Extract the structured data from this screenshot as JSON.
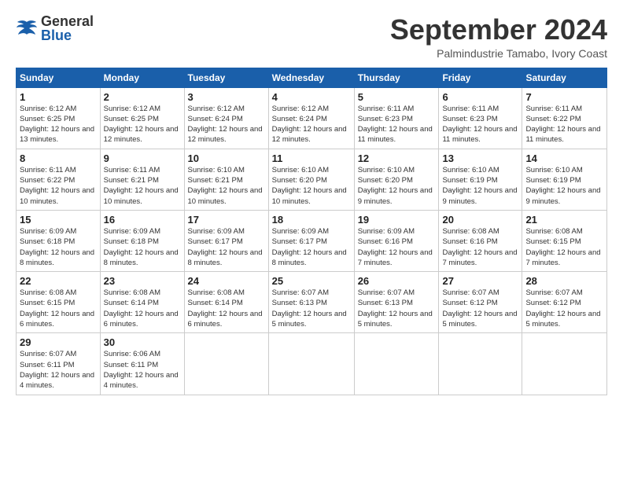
{
  "header": {
    "logo_general": "General",
    "logo_blue": "Blue",
    "month_title": "September 2024",
    "location": "Palmindustrie Tamabo, Ivory Coast"
  },
  "days_of_week": [
    "Sunday",
    "Monday",
    "Tuesday",
    "Wednesday",
    "Thursday",
    "Friday",
    "Saturday"
  ],
  "weeks": [
    [
      {
        "day": "1",
        "sunrise": "Sunrise: 6:12 AM",
        "sunset": "Sunset: 6:25 PM",
        "daylight": "Daylight: 12 hours and 13 minutes."
      },
      {
        "day": "2",
        "sunrise": "Sunrise: 6:12 AM",
        "sunset": "Sunset: 6:25 PM",
        "daylight": "Daylight: 12 hours and 12 minutes."
      },
      {
        "day": "3",
        "sunrise": "Sunrise: 6:12 AM",
        "sunset": "Sunset: 6:24 PM",
        "daylight": "Daylight: 12 hours and 12 minutes."
      },
      {
        "day": "4",
        "sunrise": "Sunrise: 6:12 AM",
        "sunset": "Sunset: 6:24 PM",
        "daylight": "Daylight: 12 hours and 12 minutes."
      },
      {
        "day": "5",
        "sunrise": "Sunrise: 6:11 AM",
        "sunset": "Sunset: 6:23 PM",
        "daylight": "Daylight: 12 hours and 11 minutes."
      },
      {
        "day": "6",
        "sunrise": "Sunrise: 6:11 AM",
        "sunset": "Sunset: 6:23 PM",
        "daylight": "Daylight: 12 hours and 11 minutes."
      },
      {
        "day": "7",
        "sunrise": "Sunrise: 6:11 AM",
        "sunset": "Sunset: 6:22 PM",
        "daylight": "Daylight: 12 hours and 11 minutes."
      }
    ],
    [
      {
        "day": "8",
        "sunrise": "Sunrise: 6:11 AM",
        "sunset": "Sunset: 6:22 PM",
        "daylight": "Daylight: 12 hours and 10 minutes."
      },
      {
        "day": "9",
        "sunrise": "Sunrise: 6:11 AM",
        "sunset": "Sunset: 6:21 PM",
        "daylight": "Daylight: 12 hours and 10 minutes."
      },
      {
        "day": "10",
        "sunrise": "Sunrise: 6:10 AM",
        "sunset": "Sunset: 6:21 PM",
        "daylight": "Daylight: 12 hours and 10 minutes."
      },
      {
        "day": "11",
        "sunrise": "Sunrise: 6:10 AM",
        "sunset": "Sunset: 6:20 PM",
        "daylight": "Daylight: 12 hours and 10 minutes."
      },
      {
        "day": "12",
        "sunrise": "Sunrise: 6:10 AM",
        "sunset": "Sunset: 6:20 PM",
        "daylight": "Daylight: 12 hours and 9 minutes."
      },
      {
        "day": "13",
        "sunrise": "Sunrise: 6:10 AM",
        "sunset": "Sunset: 6:19 PM",
        "daylight": "Daylight: 12 hours and 9 minutes."
      },
      {
        "day": "14",
        "sunrise": "Sunrise: 6:10 AM",
        "sunset": "Sunset: 6:19 PM",
        "daylight": "Daylight: 12 hours and 9 minutes."
      }
    ],
    [
      {
        "day": "15",
        "sunrise": "Sunrise: 6:09 AM",
        "sunset": "Sunset: 6:18 PM",
        "daylight": "Daylight: 12 hours and 8 minutes."
      },
      {
        "day": "16",
        "sunrise": "Sunrise: 6:09 AM",
        "sunset": "Sunset: 6:18 PM",
        "daylight": "Daylight: 12 hours and 8 minutes."
      },
      {
        "day": "17",
        "sunrise": "Sunrise: 6:09 AM",
        "sunset": "Sunset: 6:17 PM",
        "daylight": "Daylight: 12 hours and 8 minutes."
      },
      {
        "day": "18",
        "sunrise": "Sunrise: 6:09 AM",
        "sunset": "Sunset: 6:17 PM",
        "daylight": "Daylight: 12 hours and 8 minutes."
      },
      {
        "day": "19",
        "sunrise": "Sunrise: 6:09 AM",
        "sunset": "Sunset: 6:16 PM",
        "daylight": "Daylight: 12 hours and 7 minutes."
      },
      {
        "day": "20",
        "sunrise": "Sunrise: 6:08 AM",
        "sunset": "Sunset: 6:16 PM",
        "daylight": "Daylight: 12 hours and 7 minutes."
      },
      {
        "day": "21",
        "sunrise": "Sunrise: 6:08 AM",
        "sunset": "Sunset: 6:15 PM",
        "daylight": "Daylight: 12 hours and 7 minutes."
      }
    ],
    [
      {
        "day": "22",
        "sunrise": "Sunrise: 6:08 AM",
        "sunset": "Sunset: 6:15 PM",
        "daylight": "Daylight: 12 hours and 6 minutes."
      },
      {
        "day": "23",
        "sunrise": "Sunrise: 6:08 AM",
        "sunset": "Sunset: 6:14 PM",
        "daylight": "Daylight: 12 hours and 6 minutes."
      },
      {
        "day": "24",
        "sunrise": "Sunrise: 6:08 AM",
        "sunset": "Sunset: 6:14 PM",
        "daylight": "Daylight: 12 hours and 6 minutes."
      },
      {
        "day": "25",
        "sunrise": "Sunrise: 6:07 AM",
        "sunset": "Sunset: 6:13 PM",
        "daylight": "Daylight: 12 hours and 5 minutes."
      },
      {
        "day": "26",
        "sunrise": "Sunrise: 6:07 AM",
        "sunset": "Sunset: 6:13 PM",
        "daylight": "Daylight: 12 hours and 5 minutes."
      },
      {
        "day": "27",
        "sunrise": "Sunrise: 6:07 AM",
        "sunset": "Sunset: 6:12 PM",
        "daylight": "Daylight: 12 hours and 5 minutes."
      },
      {
        "day": "28",
        "sunrise": "Sunrise: 6:07 AM",
        "sunset": "Sunset: 6:12 PM",
        "daylight": "Daylight: 12 hours and 5 minutes."
      }
    ],
    [
      {
        "day": "29",
        "sunrise": "Sunrise: 6:07 AM",
        "sunset": "Sunset: 6:11 PM",
        "daylight": "Daylight: 12 hours and 4 minutes."
      },
      {
        "day": "30",
        "sunrise": "Sunrise: 6:06 AM",
        "sunset": "Sunset: 6:11 PM",
        "daylight": "Daylight: 12 hours and 4 minutes."
      },
      null,
      null,
      null,
      null,
      null
    ]
  ]
}
